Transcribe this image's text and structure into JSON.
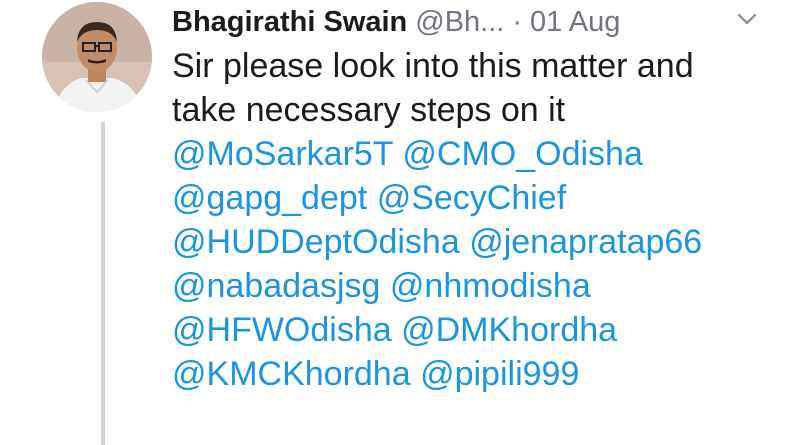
{
  "tweet": {
    "author": {
      "display_name": "Bhagirathi Swain",
      "handle": "@Bh...",
      "avatar_icon": "user-avatar-photo"
    },
    "separator": "·",
    "date": "01 Aug",
    "menu_icon": "chevron-down-icon",
    "text_lines": [
      "Sir please look into this matter and",
      "take necessary steps on it"
    ],
    "mention_lines": [
      [
        "@MoSarkar5T",
        "@CMO_Odisha"
      ],
      [
        "@gapg_dept",
        "@SecyChief"
      ],
      [
        "@HUDDeptOdisha",
        "@jenapratap66"
      ],
      [
        "@nabadasjsg",
        "@nhmodisha"
      ],
      [
        "@HFWOdisha",
        "@DMKhordha"
      ],
      [
        "@KMCKhordha",
        "@pipili999"
      ]
    ]
  },
  "colors": {
    "mention": "#1b95e0",
    "text": "#1b1b1b",
    "muted": "#6b7782",
    "thread_line": "#cfd5da"
  }
}
